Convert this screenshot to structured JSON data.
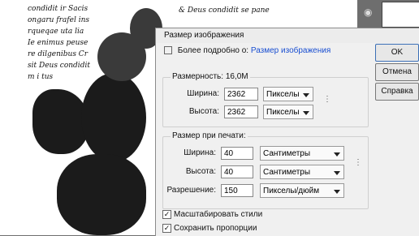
{
  "canvas": {
    "script_lines": [
      "condidit ir Sacis",
      "ongaru frafel ins",
      "rqueqae uta lia",
      "Ie enimus peuse",
      "re dilgenibus Cr",
      "sit Deus condidit",
      "m i tus"
    ],
    "script_top": [
      "& Deus condidit se pane"
    ]
  },
  "dialog": {
    "title": "Размер изображения",
    "info_prefix": "Более подробно о:",
    "info_link": "Размер изображения",
    "pixel_dims": {
      "label": "Размерность:",
      "value": "16,0M",
      "width_label": "Ширина:",
      "width_value": "2362",
      "width_unit": "Пикселы",
      "height_label": "Высота:",
      "height_value": "2362",
      "height_unit": "Пикселы"
    },
    "doc_size": {
      "label": "Размер при печати:",
      "width_label": "Ширина:",
      "width_value": "40",
      "width_unit": "Сантиметры",
      "height_label": "Высота:",
      "height_value": "40",
      "height_unit": "Сантиметры",
      "res_label": "Разрешение:",
      "res_value": "150",
      "res_unit": "Пикселы/дюйм"
    },
    "buttons": {
      "ok": "OK",
      "cancel": "Отмена",
      "help": "Справка"
    },
    "checkboxes": {
      "scale_styles": "Масштабировать стили",
      "constrain": "Сохранить пропорции"
    }
  }
}
